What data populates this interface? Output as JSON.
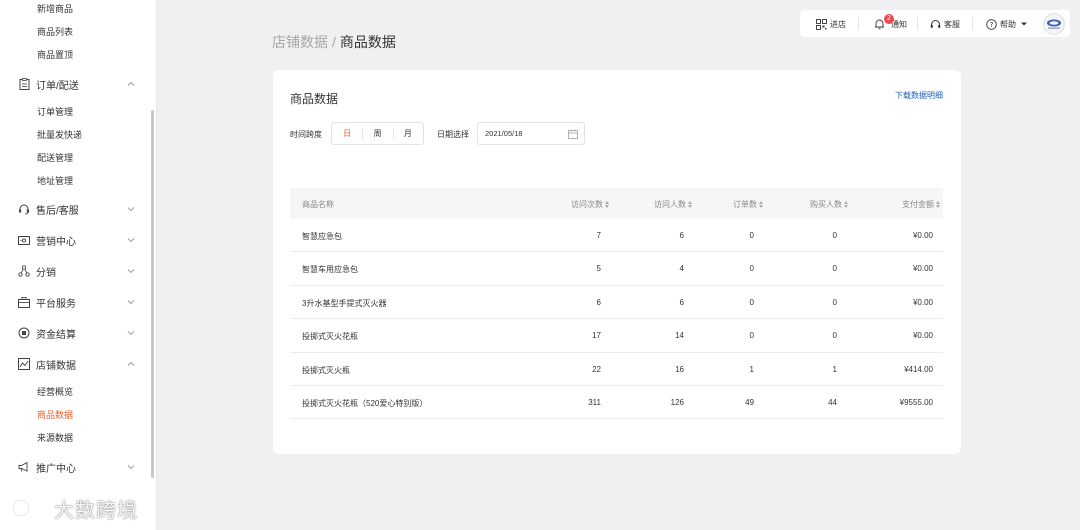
{
  "sidebar": {
    "top_sub_items": [
      "新增商品",
      "商品列表",
      "商品置顶"
    ],
    "groups": [
      {
        "label": "订单/配送",
        "icon": "clipboard-icon",
        "expanded": true,
        "items": [
          "订单管理",
          "批量发快递",
          "配送管理",
          "地址管理"
        ]
      },
      {
        "label": "售后/客服",
        "icon": "headset-icon",
        "expanded": false
      },
      {
        "label": "营销中心",
        "icon": "ticket-icon",
        "expanded": false
      },
      {
        "label": "分销",
        "icon": "network-icon",
        "expanded": false
      },
      {
        "label": "平台服务",
        "icon": "briefcase-icon",
        "expanded": false
      },
      {
        "label": "资金结算",
        "icon": "coin-icon",
        "expanded": false
      },
      {
        "label": "店铺数据",
        "icon": "chart-icon",
        "expanded": true,
        "items": [
          "经营概览",
          "商品数据",
          "来源数据"
        ],
        "active_item": "商品数据"
      },
      {
        "label": "推广中心",
        "icon": "megaphone-icon",
        "expanded": false
      }
    ]
  },
  "watermark": {
    "text": "大数跨境"
  },
  "topbar": {
    "store": "进店",
    "notice": "通知",
    "notice_count": "2",
    "service": "客服",
    "help": "帮助"
  },
  "breadcrumb": {
    "parent": "店铺数据",
    "separator": "/",
    "current": "商品数据"
  },
  "card": {
    "title": "商品数据",
    "download": "下载数据明细",
    "time_label": "时间跨度",
    "time_options": [
      "日",
      "周",
      "月"
    ],
    "time_active": "日",
    "date_label": "日期选择",
    "date_value": "2021/05/18"
  },
  "table": {
    "headers": [
      "商品名称",
      "访问次数",
      "访问人数",
      "订单数",
      "购买人数",
      "支付金额"
    ],
    "rows": [
      [
        "智慧应急包",
        "7",
        "6",
        "0",
        "0",
        "¥0.00"
      ],
      [
        "智慧车用应急包",
        "5",
        "4",
        "0",
        "0",
        "¥0.00"
      ],
      [
        "3升水基型手提式灭火器",
        "6",
        "6",
        "0",
        "0",
        "¥0.00"
      ],
      [
        "投掷式灭火花瓶",
        "17",
        "14",
        "0",
        "0",
        "¥0.00"
      ],
      [
        "投掷式灭火瓶",
        "22",
        "16",
        "1",
        "1",
        "¥414.00"
      ],
      [
        "投掷式灭火花瓶（520爱心特别版）",
        "311",
        "126",
        "49",
        "44",
        "¥9555.00"
      ]
    ]
  },
  "colors": {
    "accent": "#e9622a",
    "link": "#1f5fbd",
    "badge": "#f04848"
  }
}
